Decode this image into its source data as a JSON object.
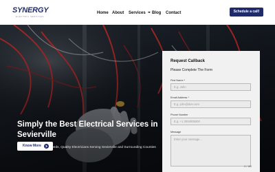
{
  "header": {
    "logo_text": "SYNERGY",
    "logo_tagline": "ELECTRIC SERVICES",
    "nav": [
      {
        "label": "Home"
      },
      {
        "label": "About"
      },
      {
        "label": "Services",
        "has_dropdown": true
      },
      {
        "label": "Blog"
      },
      {
        "label": "Contact"
      }
    ],
    "cta_label": "Schedule a call!"
  },
  "hero": {
    "title": "Simply the Best Electrical Services in Sevierville",
    "subtitle": "For All Your Electrical Needs, Quality Electricians Serving Sevierville and Surrounding Counties",
    "button_label": "Know More",
    "button_icon": "arrow-right-circle-icon"
  },
  "form": {
    "title": "Request Callback",
    "subtitle": "Please Complete The Form",
    "fields": [
      {
        "label": "First Name *",
        "placeholder": "E.g. John"
      },
      {
        "label": "Email Address *",
        "placeholder": "E.g. john@doe.com"
      },
      {
        "label": "Phone Number",
        "placeholder": "E.g. +1 3004005000"
      },
      {
        "label": "Message",
        "placeholder": "Enter your message..."
      }
    ],
    "char_counter": "0 / 180"
  },
  "colors": {
    "brand_navy": "#1f2a6b",
    "form_bg": "#f1f1f1",
    "hero_bg": "#0e1218"
  }
}
